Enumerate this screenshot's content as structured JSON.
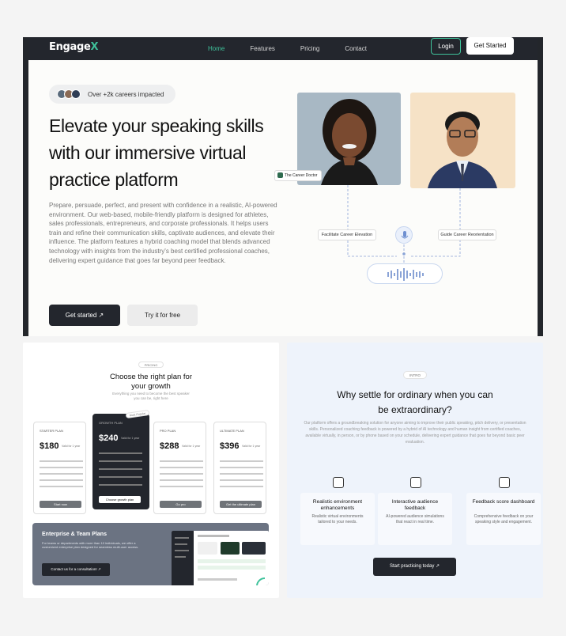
{
  "nav": {
    "logo_main": "Engage",
    "logo_accent": "X",
    "links": [
      "Home",
      "Features",
      "Pricing",
      "Contact"
    ],
    "login": "Login",
    "get_started": "Get Started",
    "accent_color": "#3fc29b"
  },
  "hero": {
    "badge": "Over +2k careers impacted",
    "title": "Elevate your speaking skills with our immersive virtual practice platform",
    "description": "Prepare, persuade, perfect, and present with confidence in a realistic, AI-powered environment. Our web-based, mobile-friendly platform is designed for athletes, sales professionals, entrepreneurs, and corporate professionals. It helps users train and refine their communication skills, captivate audiences, and elevate their influence. The platform features a hybrid coaching model that blends advanced technology with insights from the industry's best certified professional coaches, delivering expert guidance that goes far beyond peer feedback.",
    "cta_primary": "Get started",
    "cta_secondary": "Try it for free",
    "coach_tag": "The Career Doctor",
    "chip_left": "Facilitate Career Elevation",
    "chip_right": "Guide Career Reorientation"
  },
  "pricing": {
    "eyebrow": "PRICING",
    "title": "Choose the right plan for your growth",
    "subtitle": "Everything you need to become the best speaker you can be, right here",
    "popular": "Most Popular",
    "plans": [
      {
        "name": "STARTER PLAN",
        "price": "$180",
        "billed": "Valid for 1 year",
        "button": "Start now"
      },
      {
        "name": "GROWTH PLAN",
        "price": "$240",
        "billed": "Valid for 1 year",
        "button": "Choose growth plan"
      },
      {
        "name": "PRO PLAN",
        "price": "$288",
        "billed": "Valid for 1 year",
        "button": "Go pro"
      },
      {
        "name": "ULTIMATE PLAN",
        "price": "$396",
        "billed": "Valid for 1 year",
        "button": "Get the ultimate plan"
      }
    ],
    "enterprise_title": "Enterprise & Team Plans",
    "enterprise_text": "For teams or departments with more than 10 individuals, we offer a customized enterprise plan designed for seamless multi-user access.",
    "enterprise_button": "Contact us for a consultation!"
  },
  "features": {
    "eyebrow": "INTRO",
    "title": "Why settle for ordinary when you can be extraordinary?",
    "paragraph": "Our platform offers a groundbreaking solution for anyone aiming to improve their public speaking, pitch delivery, or presentation skills. Personalized coaching feedback is powered by a hybrid of AI technology and human insight from certified coaches, available virtually, in person, or by phone based on your schedule, delivering expert guidance that goes far beyond basic peer evaluation.",
    "cards": [
      {
        "title": "Realistic environment enhancements",
        "text": "Realistic virtual environments tailored to your needs."
      },
      {
        "title": "Interactive audience feedback",
        "text": "AI-powered audience simulations that react in real time."
      },
      {
        "title": "Feedback score dashboard",
        "text": "Comprehensive feedback on your speaking style and engagement."
      }
    ],
    "button": "Start practicing today"
  }
}
